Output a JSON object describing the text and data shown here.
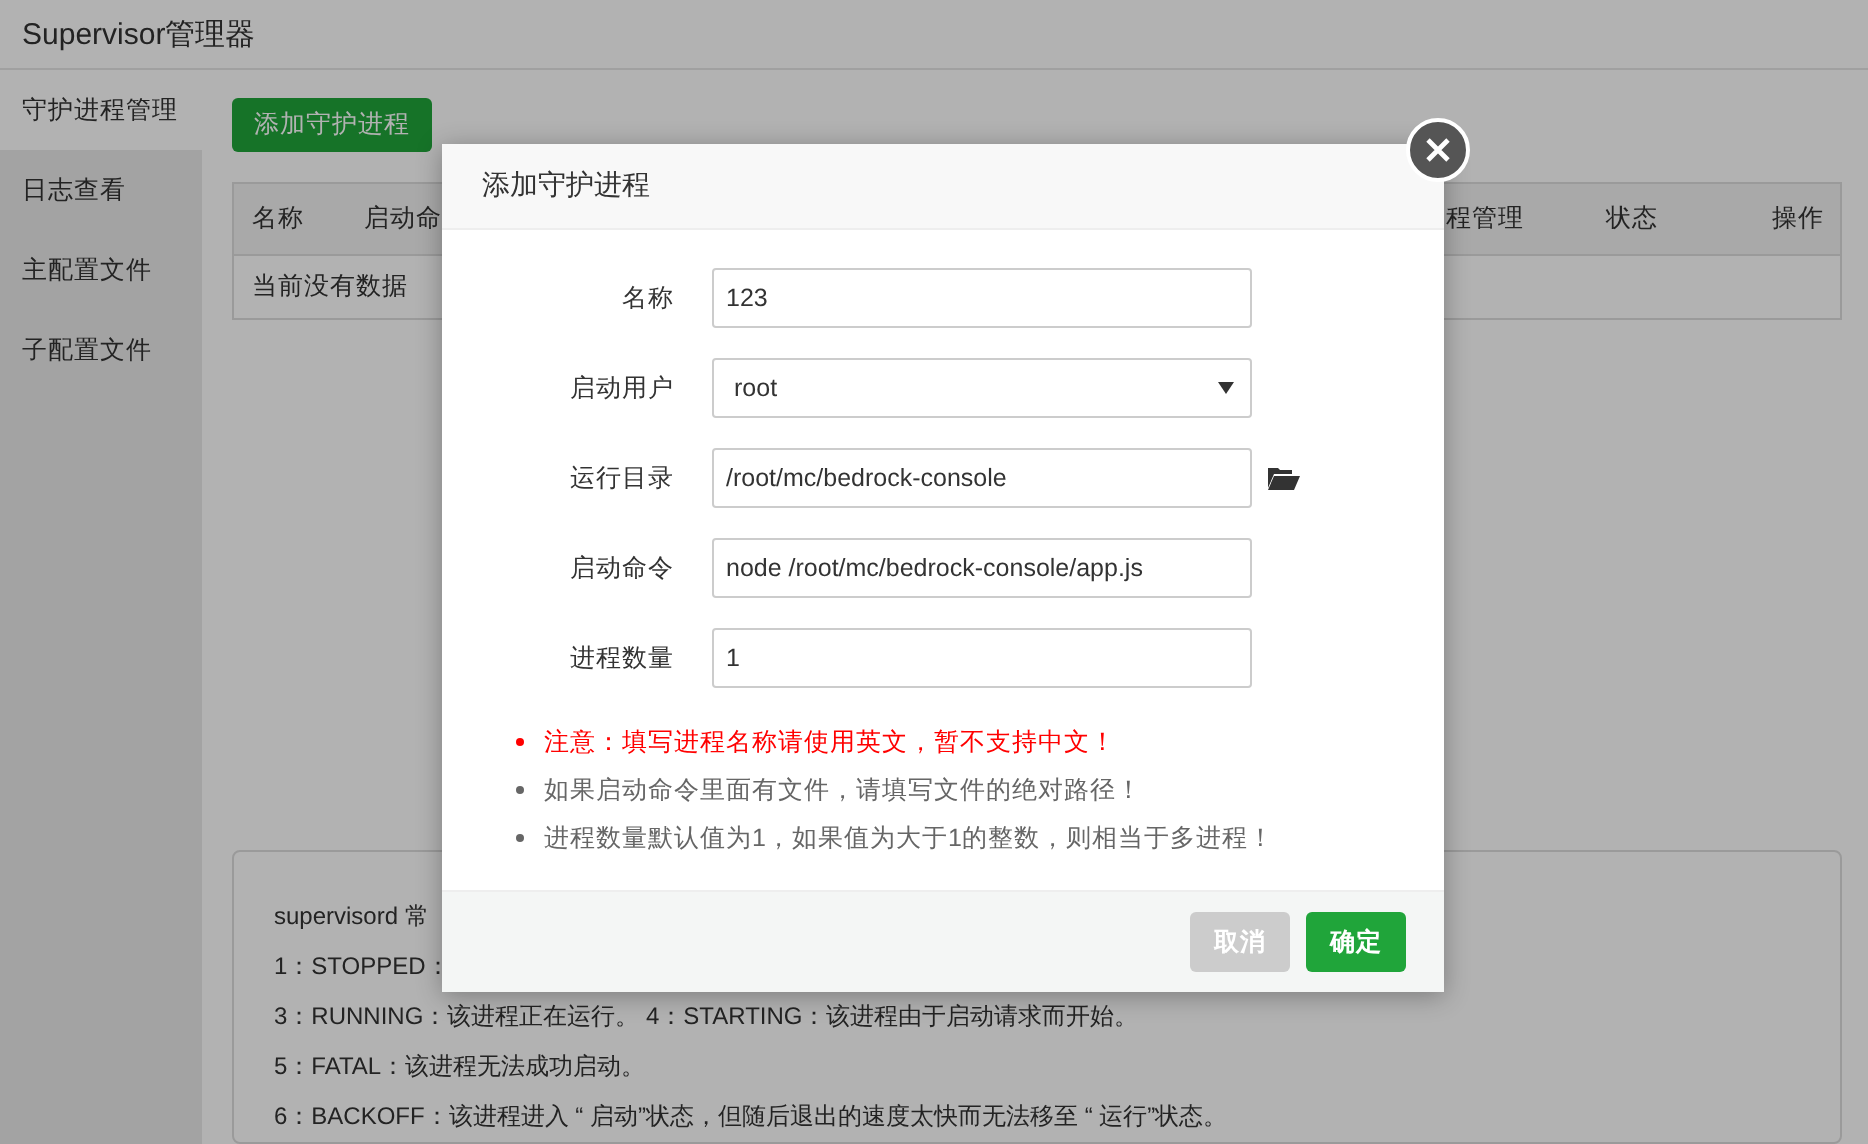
{
  "app": {
    "title": "Supervisor管理器"
  },
  "sidebar": {
    "items": [
      {
        "label": "守护进程管理",
        "selected": true
      },
      {
        "label": "日志查看",
        "selected": false
      },
      {
        "label": "主配置文件",
        "selected": false
      },
      {
        "label": "子配置文件",
        "selected": false
      }
    ]
  },
  "add_button": "添加守护进程",
  "table": {
    "columns": [
      "名称",
      "启动命",
      "程管理",
      "状态",
      "操作"
    ],
    "empty_text": "当前没有数据"
  },
  "info": {
    "lines": [
      "supervisord 常",
      "1：STOPPED：",
      "3：RUNNING：该进程正在运行。 4：STARTING：该进程由于启动请求而开始。",
      "5：FATAL：该进程无法成功启动。",
      "6：BACKOFF：该进程进入 “ 启动”状态，但随后退出的速度太快而无法移至 “ 运行”状态。"
    ]
  },
  "dialog": {
    "title": "添加守护进程",
    "fields": [
      {
        "label": "名称",
        "kind": "text",
        "value": "123"
      },
      {
        "label": "启动用户",
        "kind": "select",
        "value": "root"
      },
      {
        "label": "运行目录",
        "kind": "folder",
        "value": "/root/mc/bedrock-console"
      },
      {
        "label": "启动命令",
        "kind": "text",
        "value": "node /root/mc/bedrock-console/app.js"
      },
      {
        "label": "进程数量",
        "kind": "text",
        "value": "1"
      }
    ],
    "notes": [
      {
        "kind": "warning",
        "text": "注意：填写进程名称请使用英文，暂不支持中文！"
      },
      {
        "kind": "normal",
        "text": "如果启动命令里面有文件，请填写文件的绝对路径！"
      },
      {
        "kind": "normal",
        "text": "进程数量默认值为1，如果值为大于1的整数，则相当于多进程！"
      }
    ],
    "buttons": [
      {
        "label": "取消",
        "disabled": true
      },
      {
        "label": "确定",
        "disabled": false
      }
    ]
  }
}
